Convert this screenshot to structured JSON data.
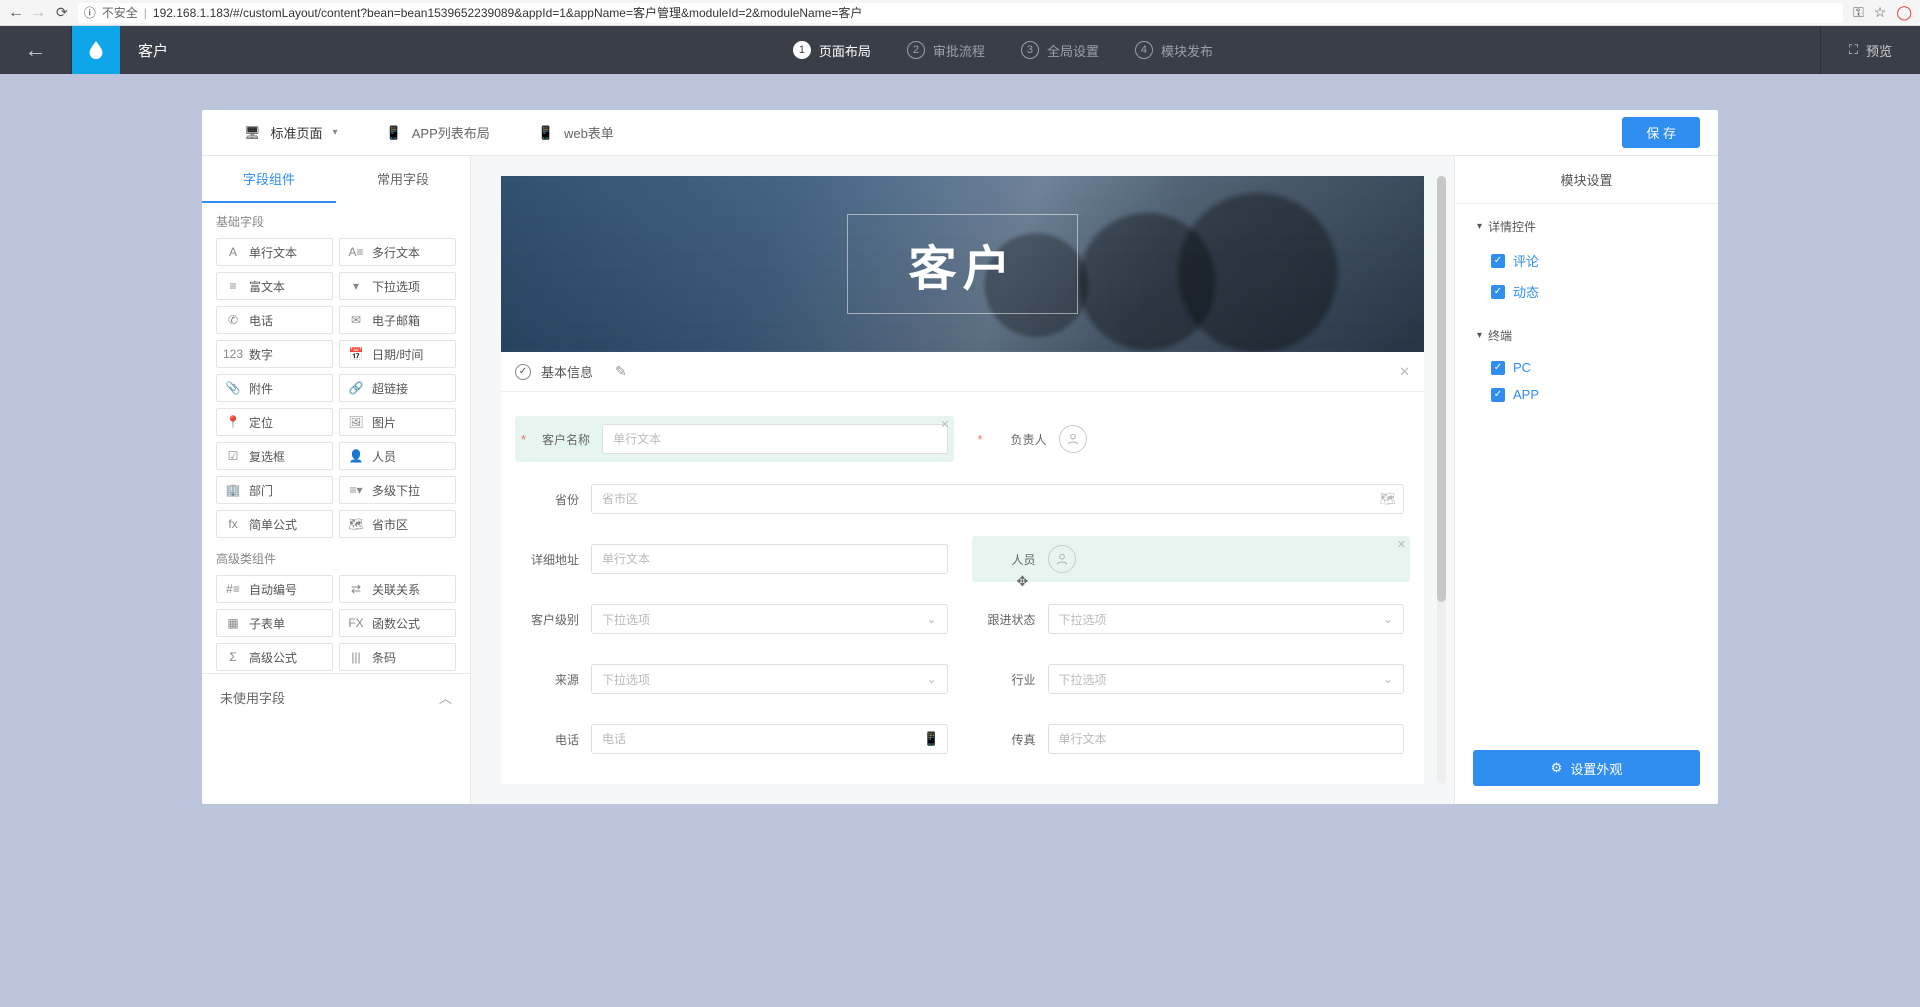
{
  "browser": {
    "unsafe_label": "不安全",
    "url": "192.168.1.183/#/customLayout/content?bean=bean1539652239089&appId=1&appName=客户管理&moduleId=2&moduleName=客户"
  },
  "topbar": {
    "title": "客户",
    "steps": [
      {
        "num": "1",
        "label": "页面布局",
        "active": true
      },
      {
        "num": "2",
        "label": "审批流程",
        "active": false
      },
      {
        "num": "3",
        "label": "全局设置",
        "active": false
      },
      {
        "num": "4",
        "label": "模块发布",
        "active": false
      }
    ],
    "preview": "预览"
  },
  "mode_tabs": {
    "standard": "标准页面",
    "app_list": "APP列表布局",
    "web_form": "web表单",
    "save": "保 存"
  },
  "left": {
    "tabs": {
      "components": "字段组件",
      "common": "常用字段"
    },
    "basic_title": "基础字段",
    "basic_fields": [
      {
        "icon": "A",
        "label": "单行文本"
      },
      {
        "icon": "A≡",
        "label": "多行文本"
      },
      {
        "icon": "≡",
        "label": "富文本"
      },
      {
        "icon": "▾",
        "label": "下拉选项"
      },
      {
        "icon": "✆",
        "label": "电话"
      },
      {
        "icon": "✉",
        "label": "电子邮箱"
      },
      {
        "icon": "123",
        "label": "数字"
      },
      {
        "icon": "📅",
        "label": "日期/时间"
      },
      {
        "icon": "📎",
        "label": "附件"
      },
      {
        "icon": "🔗",
        "label": "超链接"
      },
      {
        "icon": "📍",
        "label": "定位"
      },
      {
        "icon": "🖼",
        "label": "图片"
      },
      {
        "icon": "☑",
        "label": "复选框"
      },
      {
        "icon": "👤",
        "label": "人员"
      },
      {
        "icon": "🏢",
        "label": "部门"
      },
      {
        "icon": "≡▾",
        "label": "多级下拉"
      },
      {
        "icon": "fx",
        "label": "简单公式"
      },
      {
        "icon": "🗺",
        "label": "省市区"
      }
    ],
    "adv_title": "高级类组件",
    "adv_fields": [
      {
        "icon": "#≡",
        "label": "自动编号"
      },
      {
        "icon": "⇄",
        "label": "关联关系"
      },
      {
        "icon": "▦",
        "label": "子表单"
      },
      {
        "icon": "FX",
        "label": "函数公式"
      },
      {
        "icon": "Σ",
        "label": "高级公式"
      },
      {
        "icon": "|||",
        "label": "条码"
      }
    ],
    "unused": "未使用字段"
  },
  "canvas": {
    "banner_title": "客户",
    "section_title": "基本信息",
    "form": {
      "customer_name_label": "客户名称",
      "customer_name_ph": "单行文本",
      "owner_label": "负责人",
      "province_label": "省份",
      "province_ph": "省市区",
      "address_label": "详细地址",
      "address_ph": "单行文本",
      "person_label": "人员",
      "level_label": "客户级别",
      "level_ph": "下拉选项",
      "follow_label": "跟进状态",
      "follow_ph": "下拉选项",
      "source_label": "来源",
      "source_ph": "下拉选项",
      "industry_label": "行业",
      "industry_ph": "下拉选项",
      "phone_label": "电话",
      "phone_ph": "电话",
      "fax_label": "传真",
      "fax_ph": "单行文本"
    }
  },
  "right": {
    "title": "模块设置",
    "detail_title": "详情控件",
    "detail_items": [
      "评论",
      "动态"
    ],
    "terminal_title": "终端",
    "terminal_items": [
      "PC",
      "APP"
    ],
    "set_appearance": "设置外观"
  }
}
